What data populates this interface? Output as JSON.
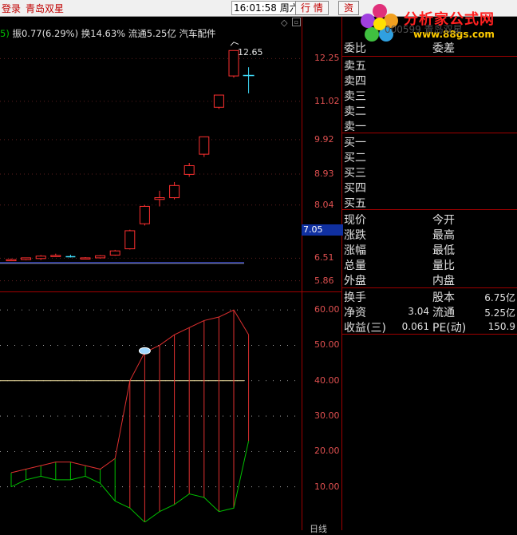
{
  "topbar": {
    "login": "登录",
    "stock_name": "青岛双星",
    "time": "16:01:58",
    "weekday": "周六",
    "btn_quote": "行  情",
    "btn_info": "资"
  },
  "info": {
    "prefix": "5)",
    "amplitude": "振0.77(6.29%)",
    "turnover": "换14.63%",
    "float_cap": "流通5.25亿",
    "industry": "汽车配件"
  },
  "logo": {
    "text": "分析家公式网",
    "url": "www.88gs.com"
  },
  "ghost_code": "000599 青岛双星",
  "price_axis": [
    "12.25",
    "11.02",
    "9.92",
    "8.93",
    "8.04",
    "6.51",
    "5.86"
  ],
  "current_price": "7.05",
  "peak_label": "12.65",
  "indicator_axis": [
    "60.00",
    "50.00",
    "40.00",
    "30.00",
    "20.00",
    "10.00"
  ],
  "bottom_tab": "日线",
  "order_book": {
    "header_left": "委比",
    "header_right": "委差",
    "sells": [
      "卖五",
      "卖四",
      "卖三",
      "卖二",
      "卖一"
    ],
    "buys": [
      "买一",
      "买二",
      "买三",
      "买四",
      "买五"
    ]
  },
  "quote": {
    "rows": [
      {
        "l": "现价",
        "r": "今开"
      },
      {
        "l": "涨跌",
        "r": "最高"
      },
      {
        "l": "涨幅",
        "r": "最低"
      },
      {
        "l": "总量",
        "r": "量比"
      },
      {
        "l": "外盘",
        "r": "内盘"
      }
    ]
  },
  "fundamentals": {
    "rows": [
      {
        "l": "换手",
        "lv": "",
        "r": "股本",
        "rv": "6.75亿"
      },
      {
        "l": "净资",
        "lv": "3.04",
        "r": "流通",
        "rv": "5.25亿"
      },
      {
        "l": "收益(三)",
        "lv": "0.061",
        "r": "PE(动)",
        "rv": "150.9"
      }
    ]
  },
  "chart_data": [
    {
      "type": "candlestick",
      "ylim": [
        5.6,
        12.9
      ],
      "candles": [
        {
          "o": 6.46,
          "h": 6.5,
          "l": 6.44,
          "c": 6.47
        },
        {
          "o": 6.47,
          "h": 6.53,
          "l": 6.45,
          "c": 6.52
        },
        {
          "o": 6.5,
          "h": 6.6,
          "l": 6.46,
          "c": 6.57
        },
        {
          "o": 6.58,
          "h": 6.64,
          "l": 6.55,
          "c": 6.59
        },
        {
          "o": 6.57,
          "h": 6.61,
          "l": 6.53,
          "c": 6.55
        },
        {
          "o": 6.51,
          "h": 6.54,
          "l": 6.48,
          "c": 6.52
        },
        {
          "o": 6.52,
          "h": 6.6,
          "l": 6.5,
          "c": 6.58
        },
        {
          "o": 6.6,
          "h": 6.75,
          "l": 6.58,
          "c": 6.72
        },
        {
          "o": 6.78,
          "h": 7.33,
          "l": 6.76,
          "c": 7.3
        },
        {
          "o": 7.5,
          "h": 8.04,
          "l": 7.45,
          "c": 8.0
        },
        {
          "o": 8.2,
          "h": 8.45,
          "l": 8.0,
          "c": 8.25
        },
        {
          "o": 8.25,
          "h": 8.7,
          "l": 8.2,
          "c": 8.6
        },
        {
          "o": 8.92,
          "h": 9.25,
          "l": 8.85,
          "c": 9.17
        },
        {
          "o": 9.5,
          "h": 9.9,
          "l": 9.42,
          "c": 10.0
        },
        {
          "o": 10.85,
          "h": 10.95,
          "l": 10.8,
          "c": 11.2
        },
        {
          "o": 11.75,
          "h": 11.9,
          "l": 11.7,
          "c": 12.48
        },
        {
          "o": 11.78,
          "h": 12.0,
          "l": 11.25,
          "c": 11.78
        }
      ]
    },
    {
      "type": "line",
      "ylim": [
        0,
        65
      ],
      "threshold": 40,
      "series": [
        {
          "name": "red",
          "values": [
            14,
            15,
            16,
            17,
            17,
            16,
            15,
            18,
            40,
            48,
            50,
            53,
            55,
            57,
            58,
            60,
            53
          ]
        },
        {
          "name": "green",
          "values": [
            10,
            12,
            13,
            12,
            12,
            13,
            11,
            6,
            4,
            0,
            3,
            5,
            8,
            7,
            3,
            4,
            23
          ]
        }
      ]
    }
  ]
}
